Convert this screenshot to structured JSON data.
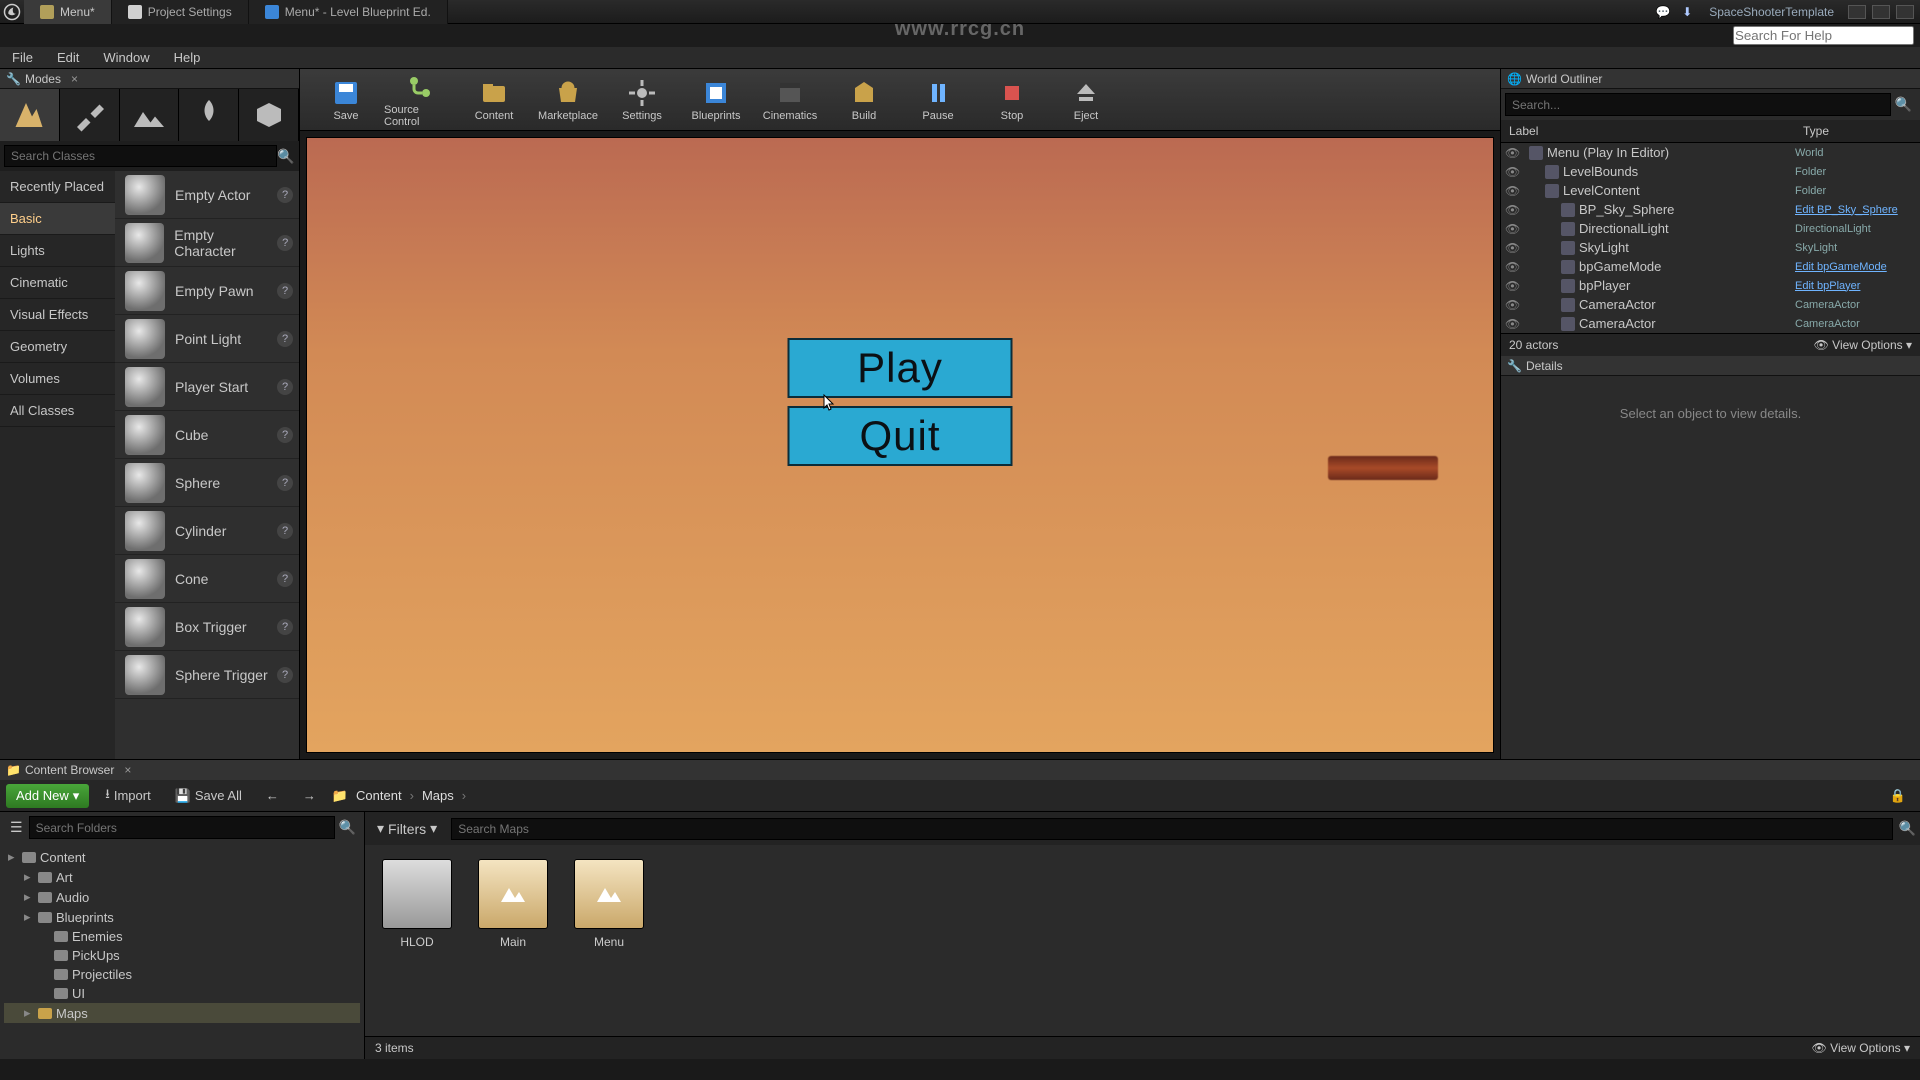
{
  "titlebar": {
    "tabs": [
      {
        "label": "Menu*",
        "icon_color": "#b19f5a"
      },
      {
        "label": "Project Settings",
        "icon_color": "#d0d0d0"
      },
      {
        "label": "Menu* - Level Blueprint Ed.",
        "icon_color": "#3b86d8"
      }
    ],
    "center_url": "www.rrcg.cn",
    "project_name": "SpaceShooterTemplate",
    "help_placeholder": "Search For Help"
  },
  "menubar": [
    "File",
    "Edit",
    "Window",
    "Help"
  ],
  "modes": {
    "tab_label": "Modes",
    "search_placeholder": "Search Classes",
    "categories": [
      "Recently Placed",
      "Basic",
      "Lights",
      "Cinematic",
      "Visual Effects",
      "Geometry",
      "Volumes",
      "All Classes"
    ],
    "selected_category": "Basic",
    "assets": [
      "Empty Actor",
      "Empty Character",
      "Empty Pawn",
      "Point Light",
      "Player Start",
      "Cube",
      "Sphere",
      "Cylinder",
      "Cone",
      "Box Trigger",
      "Sphere Trigger"
    ]
  },
  "toolbar": [
    {
      "name": "save",
      "label": "Save"
    },
    {
      "name": "source-control",
      "label": "Source Control"
    },
    {
      "name": "content",
      "label": "Content"
    },
    {
      "name": "marketplace",
      "label": "Marketplace"
    },
    {
      "name": "settings",
      "label": "Settings"
    },
    {
      "name": "blueprints",
      "label": "Blueprints"
    },
    {
      "name": "cinematics",
      "label": "Cinematics"
    },
    {
      "name": "build",
      "label": "Build"
    },
    {
      "name": "pause",
      "label": "Pause"
    },
    {
      "name": "stop",
      "label": "Stop"
    },
    {
      "name": "eject",
      "label": "Eject"
    }
  ],
  "viewport": {
    "play_label": "Play",
    "quit_label": "Quit"
  },
  "outliner": {
    "tab_label": "World Outliner",
    "search_placeholder": "Search...",
    "col_label": "Label",
    "col_type": "Type",
    "rows": [
      {
        "indent": 0,
        "label": "Menu (Play In Editor)",
        "type": "World",
        "link": false
      },
      {
        "indent": 1,
        "label": "LevelBounds",
        "type": "Folder",
        "link": false
      },
      {
        "indent": 1,
        "label": "LevelContent",
        "type": "Folder",
        "link": false
      },
      {
        "indent": 2,
        "label": "BP_Sky_Sphere",
        "type": "Edit BP_Sky_Sphere",
        "link": true
      },
      {
        "indent": 2,
        "label": "DirectionalLight",
        "type": "DirectionalLight",
        "link": false
      },
      {
        "indent": 2,
        "label": "SkyLight",
        "type": "SkyLight",
        "link": false
      },
      {
        "indent": 2,
        "label": "bpGameMode",
        "type": "Edit bpGameMode",
        "link": true
      },
      {
        "indent": 2,
        "label": "bpPlayer",
        "type": "Edit bpPlayer",
        "link": true
      },
      {
        "indent": 2,
        "label": "CameraActor",
        "type": "CameraActor",
        "link": false
      },
      {
        "indent": 2,
        "label": "CameraActor",
        "type": "CameraActor",
        "link": false
      }
    ],
    "footer_count": "20 actors",
    "footer_view": "View Options"
  },
  "details": {
    "tab_label": "Details",
    "empty_msg": "Select an object to view details."
  },
  "content_browser": {
    "tab_label": "Content Browser",
    "add_new": "Add New",
    "import": "Import",
    "save_all": "Save All",
    "breadcrumb": [
      "Content",
      "Maps"
    ],
    "folders_placeholder": "Search Folders",
    "filters_label": "Filters",
    "assets_placeholder": "Search Maps",
    "tree": [
      {
        "indent": 0,
        "label": "Content",
        "sel": false
      },
      {
        "indent": 1,
        "label": "Art",
        "sel": false
      },
      {
        "indent": 1,
        "label": "Audio",
        "sel": false
      },
      {
        "indent": 1,
        "label": "Blueprints",
        "sel": false
      },
      {
        "indent": 2,
        "label": "Enemies",
        "sel": false
      },
      {
        "indent": 2,
        "label": "PickUps",
        "sel": false
      },
      {
        "indent": 2,
        "label": "Projectiles",
        "sel": false
      },
      {
        "indent": 2,
        "label": "UI",
        "sel": false
      },
      {
        "indent": 1,
        "label": "Maps",
        "sel": true
      }
    ],
    "assets": [
      {
        "label": "HLOD",
        "map": false
      },
      {
        "label": "Main",
        "map": true
      },
      {
        "label": "Menu",
        "map": true
      }
    ],
    "footer_count": "3 items",
    "footer_view": "View Options"
  }
}
